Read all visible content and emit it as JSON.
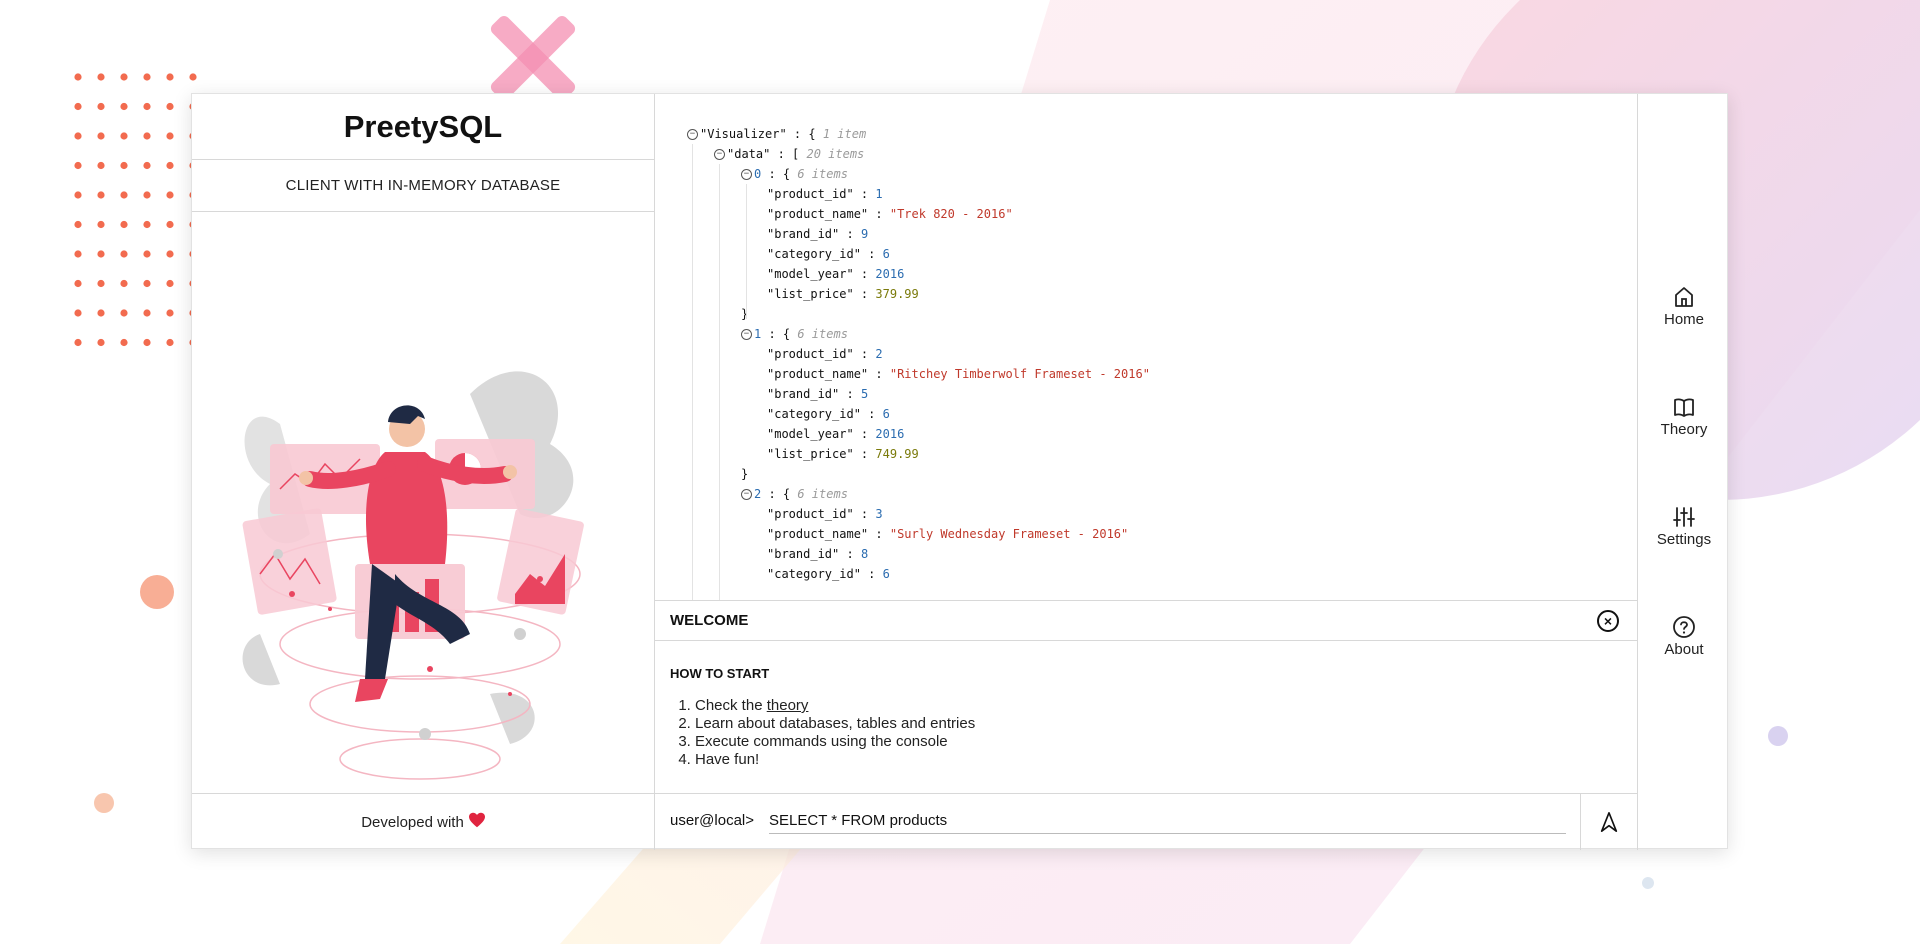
{
  "app": {
    "brand": "PreetySQL",
    "subtitle": "CLIENT WITH IN-MEMORY DATABASE",
    "footer_text": "Developed with",
    "footer_icon": "heart-icon"
  },
  "json_view": {
    "root_key": "\"Visualizer\"",
    "root_meta": "1 item",
    "data_key": "\"data\"",
    "data_meta": "20 items",
    "items": [
      {
        "index": "0",
        "meta": "6 items",
        "fields": [
          {
            "key": "\"product_id\"",
            "value": "1",
            "type": "num"
          },
          {
            "key": "\"product_name\"",
            "value": "\"Trek 820 - 2016\"",
            "type": "str"
          },
          {
            "key": "\"brand_id\"",
            "value": "9",
            "type": "num"
          },
          {
            "key": "\"category_id\"",
            "value": "6",
            "type": "num"
          },
          {
            "key": "\"model_year\"",
            "value": "2016",
            "type": "num"
          },
          {
            "key": "\"list_price\"",
            "value": "379.99",
            "type": "flt"
          }
        ]
      },
      {
        "index": "1",
        "meta": "6 items",
        "fields": [
          {
            "key": "\"product_id\"",
            "value": "2",
            "type": "num"
          },
          {
            "key": "\"product_name\"",
            "value": "\"Ritchey Timberwolf Frameset - 2016\"",
            "type": "str"
          },
          {
            "key": "\"brand_id\"",
            "value": "5",
            "type": "num"
          },
          {
            "key": "\"category_id\"",
            "value": "6",
            "type": "num"
          },
          {
            "key": "\"model_year\"",
            "value": "2016",
            "type": "num"
          },
          {
            "key": "\"list_price\"",
            "value": "749.99",
            "type": "flt"
          }
        ]
      },
      {
        "index": "2",
        "meta": "6 items",
        "fields": [
          {
            "key": "\"product_id\"",
            "value": "3",
            "type": "num"
          },
          {
            "key": "\"product_name\"",
            "value": "\"Surly Wednesday Frameset - 2016\"",
            "type": "str"
          },
          {
            "key": "\"brand_id\"",
            "value": "8",
            "type": "num"
          },
          {
            "key": "\"category_id\"",
            "value": "6",
            "type": "num"
          }
        ]
      }
    ]
  },
  "welcome": {
    "title": "WELCOME",
    "howto_title": "HOW TO START",
    "steps": [
      {
        "prefix": "Check the ",
        "link": "theory"
      },
      {
        "text": "Learn about databases, tables and entries"
      },
      {
        "text": "Execute commands using the console"
      },
      {
        "text": "Have fun!"
      }
    ]
  },
  "console": {
    "prompt": "user@local>",
    "command": "SELECT * FROM products"
  },
  "nav": [
    {
      "label": "Home",
      "icon": "home-icon"
    },
    {
      "label": "Theory",
      "icon": "book-icon"
    },
    {
      "label": "Settings",
      "icon": "sliders-icon"
    },
    {
      "label": "About",
      "icon": "help-circle-icon"
    }
  ],
  "colors": {
    "accent": "#e94560",
    "dots": "#f26b4f",
    "json_number": "#2b6cb0",
    "json_string": "#c0392b",
    "json_float": "#7a7a0a"
  }
}
